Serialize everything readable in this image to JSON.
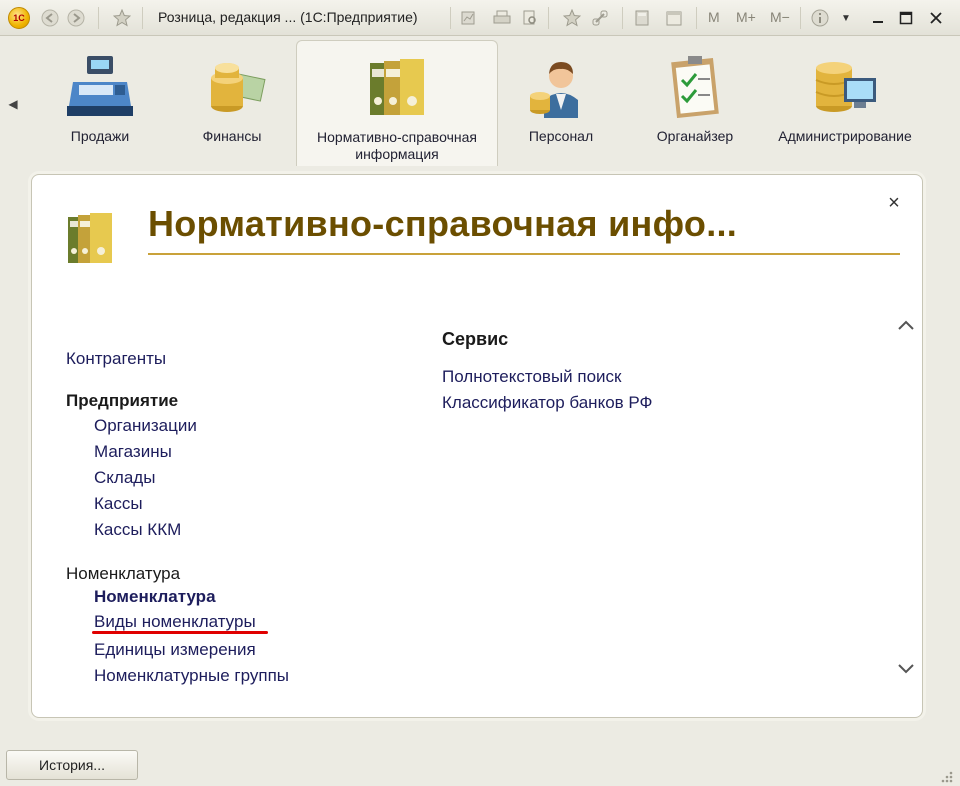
{
  "window": {
    "title": "Розница, редакция ...  (1С:Предприятие)",
    "logo_text": "1С",
    "toolbar_m": "M",
    "toolbar_m_plus": "M+",
    "toolbar_m_minus": "M−"
  },
  "sections": [
    {
      "label": "Продажи",
      "icon": "cash-register-icon"
    },
    {
      "label": "Финансы",
      "icon": "coins-money-icon"
    },
    {
      "label": "Нормативно-справочная информация",
      "icon": "binders-icon",
      "active": true
    },
    {
      "label": "Персонал",
      "icon": "employee-icon"
    },
    {
      "label": "Органайзер",
      "icon": "clipboard-icon"
    },
    {
      "label": "Администрирование",
      "icon": "database-monitor-icon"
    }
  ],
  "panel": {
    "title": "Нормативно-справочная инфо...",
    "close_glyph": "×",
    "left": {
      "contractors": "Контрагенты",
      "enterprise": {
        "heading": "Предприятие",
        "items": [
          "Организации",
          "Магазины",
          "Склады",
          "Кассы",
          "Кассы ККМ"
        ]
      },
      "nomenclature": {
        "heading": "Номенклатура",
        "items": [
          "Номенклатура",
          "Виды номенклатуры",
          "Единицы измерения",
          "Номенклатурные группы"
        ]
      }
    },
    "right": {
      "heading": "Сервис",
      "items": [
        "Полнотекстовый поиск",
        "Классификатор банков РФ"
      ]
    }
  },
  "bottom": {
    "history_label": "История..."
  },
  "colors": {
    "title_brown": "#6b4e00",
    "underline_gold": "#c9a23a",
    "highlight_red": "#e00000",
    "link_navy": "#1d1d5c"
  }
}
